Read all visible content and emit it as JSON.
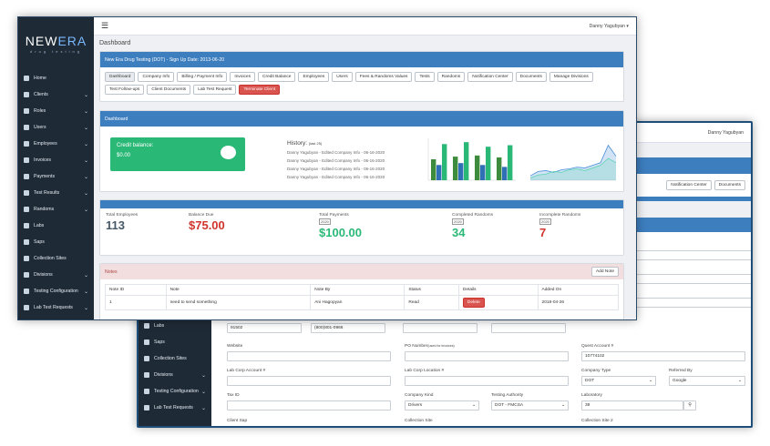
{
  "brand": {
    "logo_main": "NEW",
    "logo_accent": "ERA",
    "tagline": "drug testing"
  },
  "front": {
    "user": "Danny Yagubyan",
    "page_title": "Dashboard",
    "company_header": "New Era Drug Testing (DOT) - Sign Up Date: 2013-06-20",
    "nav": [
      "Home",
      "Clients",
      "Roles",
      "Users",
      "Employees",
      "Invoices",
      "Payments",
      "Test Results",
      "Randoms",
      "Labs",
      "Saps",
      "Collection Sites",
      "Divisions",
      "Testing Configuration",
      "Lab Test Requests"
    ],
    "nav_chev": [
      false,
      true,
      true,
      true,
      true,
      true,
      true,
      true,
      true,
      false,
      false,
      false,
      true,
      true,
      true
    ],
    "buttons": [
      "Dashboard",
      "Company Info",
      "Billing / Payment Info",
      "Invoices",
      "Credit Balance",
      "Employees",
      "Users",
      "Fees & Randoms Values",
      "Tests",
      "Randoms",
      "Notification Center",
      "Documents",
      "Manage Divisions",
      "Test Follow-ups",
      "Client Documents",
      "Lab Test Request",
      "Terminate Client"
    ],
    "dashboard_header": "Dashboard",
    "credit": {
      "label": "Credit balance:",
      "value": "$0.00"
    },
    "history": {
      "title": "History:",
      "count": "(last 25)",
      "entries": [
        "Danny Yagubyan - Edited Company Info - 06-16-2020",
        "Danny Yagubyan - Edited Company Info - 06-16-2020",
        "Danny Yagubyan - Edited Company Info - 06-16-2020",
        "Danny Yagubyan - Edited Company Info - 06-16-2020"
      ]
    },
    "stats": [
      {
        "label": "Total Employees",
        "value": "113",
        "color": "#455868",
        "select": ""
      },
      {
        "label": "Balance Due",
        "value": "$75.00",
        "color": "#d0342c",
        "select": ""
      },
      {
        "label": "Total Payments",
        "value": "$100.00",
        "color": "#2ab877",
        "select": "2020"
      },
      {
        "label": "Completed Randoms",
        "value": "34",
        "color": "#2ab877",
        "select": "2020"
      },
      {
        "label": "Incomplete Randoms",
        "value": "7",
        "color": "#d0342c",
        "select": "2020"
      }
    ],
    "notes": {
      "title": "Notes",
      "add": "Add Note",
      "cols": [
        "Note ID",
        "Note",
        "Note By",
        "Status",
        "Details",
        "Added On"
      ],
      "row": [
        "1",
        "need to send something",
        "Ani Hagopyan",
        "Read",
        "Delete",
        "2018-04-26"
      ]
    }
  },
  "back": {
    "user": "Danny Yagubyan",
    "buttons": [
      "Notification Center",
      "Documents"
    ],
    "nav": [
      "Labs",
      "Saps",
      "Collection Sites",
      "Divisions",
      "Testing Configuration",
      "Lab Test Requests"
    ],
    "phone_values": [
      "91502",
      "(800)801-0966"
    ],
    "fields": [
      {
        "label": "Website",
        "value": ""
      },
      {
        "label": "PO Number",
        "note": "(used for invoices)",
        "value": ""
      },
      {
        "label": "Quest Account #",
        "value": "10774102"
      },
      {
        "label": "Lab Corp Account #",
        "value": ""
      },
      {
        "label": "Lab Corp Location #",
        "value": ""
      },
      {
        "label": "Company Type",
        "value": "DOT"
      },
      {
        "label": "Referred By",
        "value": "Google"
      },
      {
        "label": "Tax ID",
        "value": ""
      },
      {
        "label": "Company Kind",
        "value": "Drivers"
      },
      {
        "label": "Testing Authority",
        "value": "DOT - FMCSA"
      },
      {
        "label": "Laboratory",
        "value": "39"
      },
      {
        "label": "Client Sap",
        "value": ""
      },
      {
        "label": "Collection Site",
        "value": ""
      },
      {
        "label": "Collection Site 2",
        "value": ""
      }
    ]
  },
  "chart_data": [
    {
      "type": "bar",
      "title": "",
      "categories": [
        "1",
        "2",
        "3",
        "4"
      ],
      "series": [
        {
          "name": "",
          "color": "#3d8b3d",
          "values": [
            55,
            62,
            65,
            60
          ]
        },
        {
          "name": "",
          "color": "#2f6fb5",
          "values": [
            40,
            45,
            40,
            35
          ]
        },
        {
          "name": "",
          "color": "#2ab877",
          "values": [
            95,
            100,
            88,
            92
          ]
        }
      ],
      "ylim": [
        0,
        110
      ]
    },
    {
      "type": "area",
      "title": "",
      "x": [
        1,
        2,
        3,
        4,
        5,
        6,
        7,
        8,
        9,
        10,
        11,
        12
      ],
      "series": [
        {
          "name": "",
          "color": "#4a90d9",
          "values": [
            10,
            20,
            22,
            18,
            24,
            26,
            30,
            28,
            34,
            40,
            80,
            55
          ]
        },
        {
          "name": "",
          "color": "#5fd3b5",
          "values": [
            5,
            12,
            14,
            20,
            18,
            24,
            26,
            22,
            28,
            34,
            50,
            40
          ]
        }
      ],
      "ylim": [
        0,
        100
      ]
    }
  ]
}
